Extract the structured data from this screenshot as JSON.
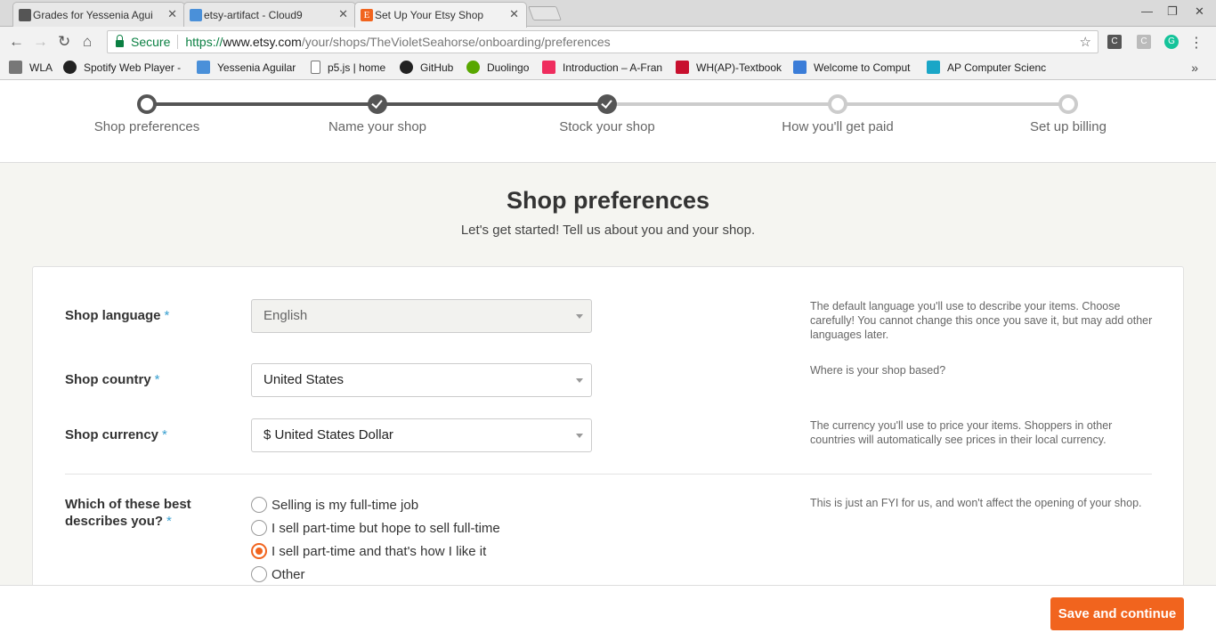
{
  "browser": {
    "tabs": [
      {
        "title": "Grades for Yessenia Aguilar",
        "favicon": "canvas-icon"
      },
      {
        "title": "etsy-artifact - Cloud9",
        "favicon": "cloud9-icon"
      },
      {
        "title": "Set Up Your Etsy Shop",
        "favicon": "etsy-icon",
        "active": true
      }
    ],
    "security_label": "Secure",
    "url_scheme": "https://",
    "url_host": "www.etsy.com",
    "url_path": "/your/shops/TheVioletSeahorse/onboarding/preferences",
    "bookmarks": [
      {
        "label": "WLA",
        "icon": "folder-icon"
      },
      {
        "label": "Spotify Web Player -",
        "icon": "spotify-icon"
      },
      {
        "label": "Yessenia Aguilar",
        "icon": "cloud-icon"
      },
      {
        "label": "p5.js | home",
        "icon": "page-icon"
      },
      {
        "label": "GitHub",
        "icon": "github-icon"
      },
      {
        "label": "Duolingo",
        "icon": "duolingo-icon"
      },
      {
        "label": "Introduction – A-Fran",
        "icon": "aframe-icon"
      },
      {
        "label": "WH(AP)-Textbook",
        "icon": "textbook-icon"
      },
      {
        "label": "Welcome to Comput",
        "icon": "graduation-cap-icon"
      },
      {
        "label": "AP Computer Scienc",
        "icon": "ed-icon"
      }
    ]
  },
  "steps": [
    {
      "label": "Shop preferences",
      "state": "current"
    },
    {
      "label": "Name your shop",
      "state": "done"
    },
    {
      "label": "Stock your shop",
      "state": "done"
    },
    {
      "label": "How you'll get paid",
      "state": "todo"
    },
    {
      "label": "Set up billing",
      "state": "todo"
    }
  ],
  "header": {
    "title": "Shop preferences",
    "subtitle": "Let's get started! Tell us about you and your shop."
  },
  "form": {
    "required_mark": "*",
    "language": {
      "label": "Shop language",
      "value": "English",
      "help": "The default language you'll use to describe your items. Choose carefully! You cannot change this once you save it, but may add other languages later."
    },
    "country": {
      "label": "Shop country",
      "value": "United States",
      "help": "Where is your shop based?"
    },
    "currency": {
      "label": "Shop currency",
      "value": "$ United States Dollar",
      "help": "The currency you'll use to price your items. Shoppers in other countries will automatically see prices in their local currency."
    },
    "describe": {
      "label": "Which of these best describes you?",
      "help": "This is just an FYI for us, and won't affect the opening of your shop.",
      "options": [
        {
          "label": "Selling is my full-time job",
          "checked": false
        },
        {
          "label": "I sell part-time but hope to sell full-time",
          "checked": false
        },
        {
          "label": "I sell part-time and that's how I like it",
          "checked": true
        },
        {
          "label": "Other",
          "checked": false
        }
      ]
    }
  },
  "footer": {
    "save_label": "Save and continue"
  },
  "colors": {
    "accent": "#f1641e",
    "required": "#3aa0d0",
    "step_done": "#555555",
    "step_todo": "#cccccc"
  }
}
